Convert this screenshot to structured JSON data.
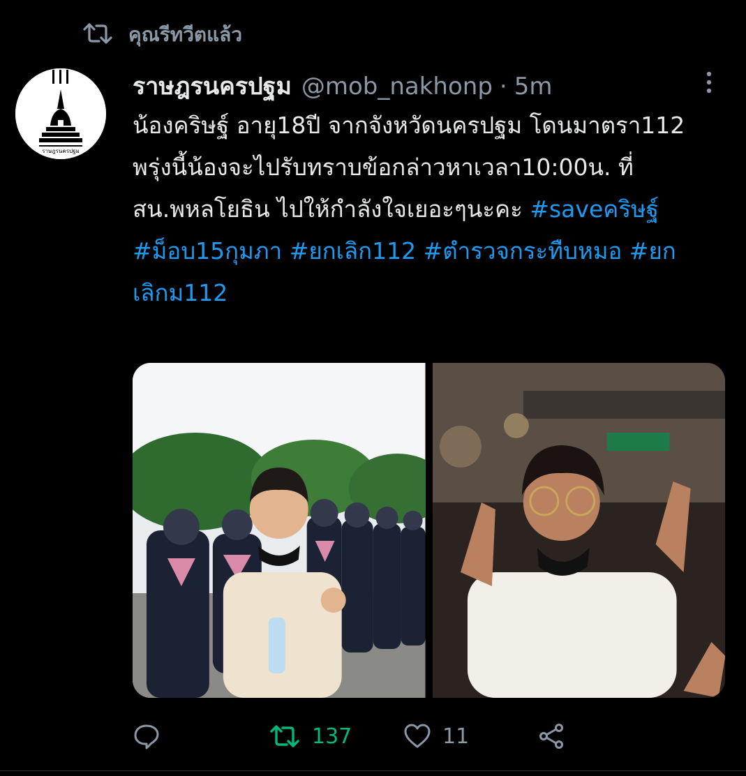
{
  "social_context": {
    "label": "คุณรีทวีตแล้ว",
    "icon": "retweet-icon"
  },
  "author": {
    "display_name": "ราษฎรนครปฐม",
    "handle": "@mob_nakhonp",
    "separator": "·",
    "time": "5m",
    "avatar_caption": "ราษฎรนครปฐม"
  },
  "tweet": {
    "text_plain": "น้องคริษฐ์ อายุ18ปี จากจังหวัดนครปฐม โดนมาตรา112 พรุ่งนี้น้องจะไปรับทราบข้อกล่าวหาเวลา10:00น. ที่สน.พหลโยธิน ไปให้กำลังใจเยอะๆนะคะ ",
    "hashtags": [
      "#saveคริษฐ์",
      "#ม็อบ15กุมภา",
      "#ยกเลิก112",
      "#ตำรวจกระทืบหมอ",
      "#ยกเลิกม112"
    ]
  },
  "media": {
    "count": 2
  },
  "actions": {
    "reply_count": "",
    "retweet_count": "137",
    "like_count": "11"
  },
  "colors": {
    "background": "#000000",
    "text": "#e7e9ea",
    "secondary": "#8b98a5",
    "link": "#1d9bf0",
    "retweet_active": "#00ba7c"
  }
}
